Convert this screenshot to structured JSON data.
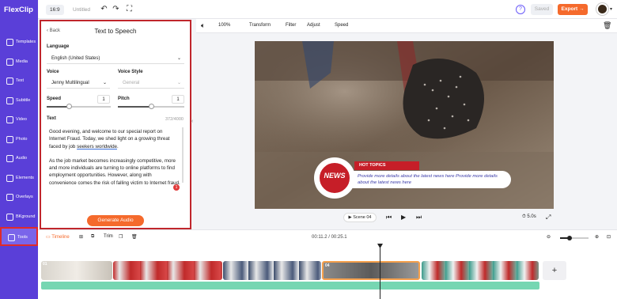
{
  "app": {
    "logo": "FlexClip",
    "ratio": "16:9",
    "project_title": "Untitled"
  },
  "topbar": {
    "help": "?",
    "saved": "Saved",
    "export": "Export →"
  },
  "sidebar": {
    "items": [
      {
        "label": "Templates",
        "icon": "templates-icon"
      },
      {
        "label": "Media",
        "icon": "media-icon"
      },
      {
        "label": "Text",
        "icon": "text-icon"
      },
      {
        "label": "Subtitle",
        "icon": "subtitle-icon"
      },
      {
        "label": "Video",
        "icon": "video-icon"
      },
      {
        "label": "Photo",
        "icon": "photo-icon"
      },
      {
        "label": "Audio",
        "icon": "audio-icon"
      },
      {
        "label": "Elements",
        "icon": "elements-icon"
      },
      {
        "label": "Overlays",
        "icon": "overlays-icon"
      },
      {
        "label": "BKground",
        "icon": "background-icon"
      },
      {
        "label": "Tools",
        "icon": "tools-icon"
      }
    ],
    "active": "Tools"
  },
  "tts": {
    "back": "Back",
    "title": "Text to Speech",
    "language_label": "Language",
    "language_value": "English (United States)",
    "voice_label": "Voice",
    "voice_value": "Jenny Multilingual",
    "voice_style_label": "Voice Style",
    "voice_style_value": "General",
    "speed_label": "Speed",
    "speed_value": "1",
    "speed_level": 0.35,
    "pitch_label": "Pitch",
    "pitch_value": "1",
    "pitch_level": 0.5,
    "text_label": "Text",
    "char_count": "372/4000",
    "para1_a": "Good evening, and welcome to our special report on Internet Fraud. Today, we shed light on a growing threat faced by job ",
    "para1_u": "seekers worldwide",
    "para1_b": ".",
    "para2": "As the job market becomes increasingly competitive, more and more individuals are turning to online platforms to find employment opportunities. However, along with convenience comes the risk of falling victim to Internet fraud.",
    "error_badge": "1",
    "generate": "Generate Audio"
  },
  "editor_toolbar": {
    "zoom": "100%",
    "transform": "Transform",
    "filter": "Filter",
    "adjust": "Adjust",
    "speed": "Speed"
  },
  "overlay": {
    "badge": "NEWS",
    "hot_topics": "HOT TOPICS",
    "ticker": "Provide more details about the latest news here  Provide more details about the latest news here"
  },
  "player": {
    "scene": "Scene 04",
    "duration": "5.0s"
  },
  "timeline": {
    "tab_timeline": "Timeline",
    "trim": "Trim",
    "time": "00:11.2 / 00:25.1",
    "zoom_level": 0.33,
    "clip_labels": [
      "01",
      "04"
    ],
    "add": "+"
  },
  "colors": {
    "brand": "#5a3fd8",
    "accent": "#f56a2c",
    "highlight": "#c0262c",
    "news_red": "#c61e28",
    "audio": "#5ecfa5"
  }
}
